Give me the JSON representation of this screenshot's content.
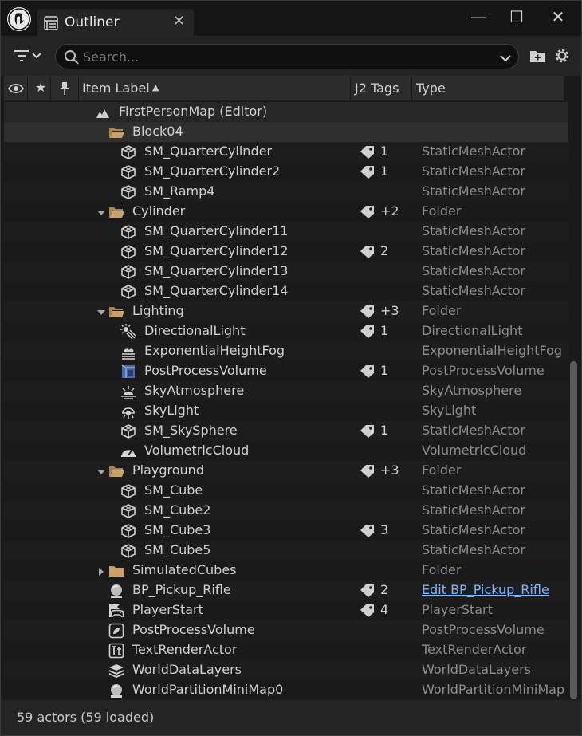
{
  "window": {
    "tab_title": "Outliner",
    "tab_close": "✕",
    "minimize": "—",
    "maximize": "☐",
    "close": "✕"
  },
  "toolbar": {
    "search_placeholder": "Search..."
  },
  "header": {
    "col_label": "Item Label",
    "col_tags": "J2 Tags",
    "col_type": "Type",
    "sort_indicator": "▲"
  },
  "rows": [
    {
      "label": "FirstPersonMap (Editor)",
      "type": "",
      "tags": "",
      "depth": 0,
      "icon": "map-icon",
      "arrow": "",
      "style": "world"
    },
    {
      "label": "Block04",
      "type": "",
      "tags": "",
      "depth": 1,
      "icon": "folder-open-icon",
      "arrow": "",
      "style": "selected"
    },
    {
      "label": "SM_QuarterCylinder",
      "type": "StaticMeshActor",
      "tags": "1",
      "depth": 2,
      "icon": "static-mesh-icon",
      "arrow": ""
    },
    {
      "label": "SM_QuarterCylinder2",
      "type": "StaticMeshActor",
      "tags": "1",
      "depth": 2,
      "icon": "static-mesh-icon",
      "arrow": ""
    },
    {
      "label": "SM_Ramp4",
      "type": "StaticMeshActor",
      "tags": "",
      "depth": 2,
      "icon": "static-mesh-icon",
      "arrow": ""
    },
    {
      "label": "Cylinder",
      "type": "Folder",
      "tags": "+2",
      "depth": 1,
      "icon": "folder-open-icon",
      "arrow": "down"
    },
    {
      "label": "SM_QuarterCylinder11",
      "type": "StaticMeshActor",
      "tags": "",
      "depth": 2,
      "icon": "static-mesh-icon",
      "arrow": ""
    },
    {
      "label": "SM_QuarterCylinder12",
      "type": "StaticMeshActor",
      "tags": "2",
      "depth": 2,
      "icon": "static-mesh-icon",
      "arrow": ""
    },
    {
      "label": "SM_QuarterCylinder13",
      "type": "StaticMeshActor",
      "tags": "",
      "depth": 2,
      "icon": "static-mesh-icon",
      "arrow": ""
    },
    {
      "label": "SM_QuarterCylinder14",
      "type": "StaticMeshActor",
      "tags": "",
      "depth": 2,
      "icon": "static-mesh-icon",
      "arrow": ""
    },
    {
      "label": "Lighting",
      "type": "Folder",
      "tags": "+3",
      "depth": 1,
      "icon": "folder-open-icon",
      "arrow": "down"
    },
    {
      "label": "DirectionalLight",
      "type": "DirectionalLight",
      "tags": "1",
      "depth": 2,
      "icon": "directional-light-icon",
      "arrow": ""
    },
    {
      "label": "ExponentialHeightFog",
      "type": "ExponentialHeightFog",
      "tags": "",
      "depth": 2,
      "icon": "fog-icon",
      "arrow": ""
    },
    {
      "label": "PostProcessVolume",
      "type": "PostProcessVolume",
      "tags": "1",
      "depth": 2,
      "icon": "volume-cube-icon",
      "arrow": ""
    },
    {
      "label": "SkyAtmosphere",
      "type": "SkyAtmosphere",
      "tags": "",
      "depth": 2,
      "icon": "sky-atmosphere-icon",
      "arrow": ""
    },
    {
      "label": "SkyLight",
      "type": "SkyLight",
      "tags": "",
      "depth": 2,
      "icon": "skylight-icon",
      "arrow": ""
    },
    {
      "label": "SM_SkySphere",
      "type": "StaticMeshActor",
      "tags": "1",
      "depth": 2,
      "icon": "static-mesh-icon",
      "arrow": ""
    },
    {
      "label": "VolumetricCloud",
      "type": "VolumetricCloud",
      "tags": "",
      "depth": 2,
      "icon": "cloud-gauge-icon",
      "arrow": ""
    },
    {
      "label": "Playground",
      "type": "Folder",
      "tags": "+3",
      "depth": 1,
      "icon": "folder-open-icon",
      "arrow": "down"
    },
    {
      "label": "SM_Cube",
      "type": "StaticMeshActor",
      "tags": "",
      "depth": 2,
      "icon": "static-mesh-icon",
      "arrow": ""
    },
    {
      "label": "SM_Cube2",
      "type": "StaticMeshActor",
      "tags": "",
      "depth": 2,
      "icon": "static-mesh-icon",
      "arrow": ""
    },
    {
      "label": "SM_Cube3",
      "type": "StaticMeshActor",
      "tags": "3",
      "depth": 2,
      "icon": "static-mesh-icon",
      "arrow": ""
    },
    {
      "label": "SM_Cube5",
      "type": "StaticMeshActor",
      "tags": "",
      "depth": 2,
      "icon": "static-mesh-icon",
      "arrow": ""
    },
    {
      "label": "SimulatedCubes",
      "type": "Folder",
      "tags": "",
      "depth": 1,
      "icon": "folder-closed-icon",
      "arrow": "right"
    },
    {
      "label": "BP_Pickup_Rifle",
      "type": "Edit BP_Pickup_Rifle",
      "tags": "2",
      "depth": 1,
      "icon": "blueprint-actor-icon",
      "arrow": "",
      "type_link": true
    },
    {
      "label": "PlayerStart",
      "type": "PlayerStart",
      "tags": "4",
      "depth": 1,
      "icon": "player-start-icon",
      "arrow": ""
    },
    {
      "label": "PostProcessVolume",
      "type": "PostProcessVolume",
      "tags": "",
      "depth": 1,
      "icon": "post-process-icon",
      "arrow": ""
    },
    {
      "label": "TextRenderActor",
      "type": "TextRenderActor",
      "tags": "",
      "depth": 1,
      "icon": "text-render-icon",
      "arrow": ""
    },
    {
      "label": "WorldDataLayers",
      "type": "WorldDataLayers",
      "tags": "",
      "depth": 1,
      "icon": "layers-icon",
      "arrow": ""
    },
    {
      "label": "WorldPartitionMiniMap0",
      "type": "WorldPartitionMiniMap",
      "tags": "",
      "depth": 1,
      "icon": "minimap-icon",
      "arrow": ""
    }
  ],
  "status": {
    "text": "59 actors (59 loaded)"
  },
  "colors": {
    "link": "#7fb4ff",
    "folder": "#c9a26a",
    "selected_row": "#2f2f2f"
  }
}
